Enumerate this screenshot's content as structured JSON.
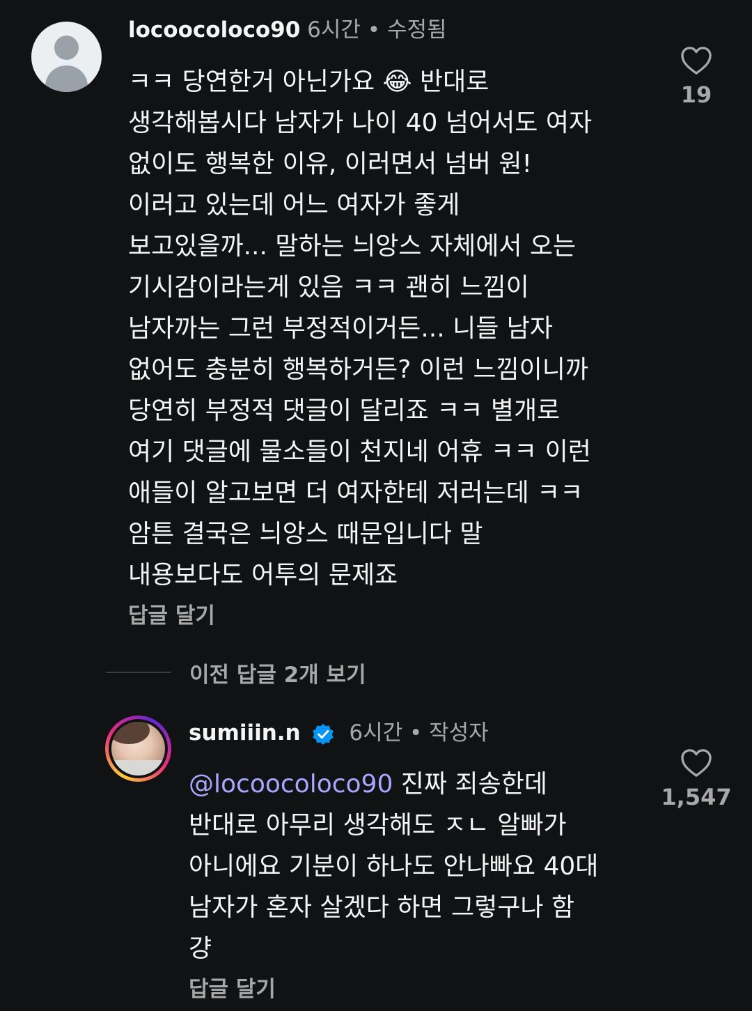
{
  "comment1": {
    "username": "locoocoloco90",
    "time": "6시간",
    "separator": "•",
    "edited": "수정됨",
    "lines": [
      "ㅋㅋ 당연한거 아닌가요 😂 반대로",
      "생각해봅시다 남자가 나이 40 넘어서도 여자",
      "없이도 행복한 이유, 이러면서 넘버 원!",
      "이러고 있는데 어느 여자가 좋게",
      "보고있을까... 말하는 늬앙스 자체에서 오는",
      "기시감이라는게 있음 ㅋㅋ 괜히 느낌이",
      "남자까는 그런 부정적이거든... 니들 남자",
      "없어도 충분히 행복하거든? 이런 느낌이니까",
      "당연히 부정적 댓글이 달리죠 ㅋㅋ 별개로",
      "여기 댓글에 물소들이 천지네 어휴 ㅋㅋ 이런",
      "애들이 알고보면 더 여자한테 저러는데 ㅋㅋ",
      "암튼 결국은 늬앙스 때문입니다 말",
      "내용보다도 어투의 문제죠"
    ],
    "reply_label": "답글 달기",
    "like_count": "19"
  },
  "view_previous": "이전 답글 2개 보기",
  "comment2": {
    "username": "sumiiin.n",
    "time": "6시간",
    "separator": "•",
    "author_badge": "작성자",
    "mention": "@locoocoloco90",
    "lines": [
      " 진짜 죄송한데",
      "반대로 아무리 생각해도 ㅈㄴ 알빠가",
      "아니에요 기분이 하나도 안나빠요 40대",
      "남자가 혼자 살겠다 하면 그렇구나 함",
      "걍"
    ],
    "reply_label": "답글 달기",
    "like_count": "1,547"
  },
  "colors": {
    "background": "#101214",
    "text": "#f5f5f5",
    "secondary": "#a8a8a8",
    "mention": "#a9a6ff",
    "verified": "#0095f6"
  },
  "icons": [
    "heart-icon",
    "verified-badge-icon",
    "default-avatar-icon"
  ]
}
